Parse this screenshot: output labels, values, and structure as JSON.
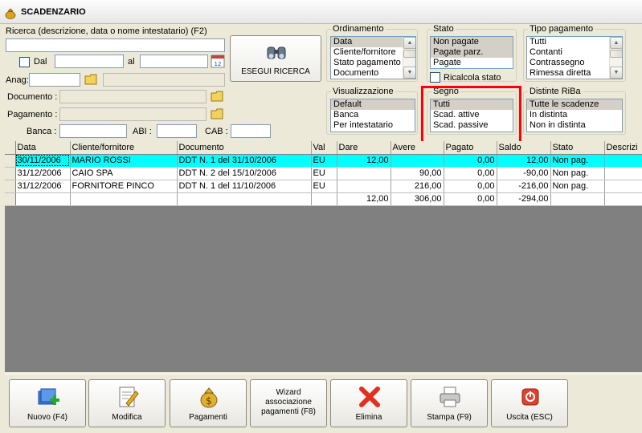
{
  "window": {
    "title": "SCADENZARIO"
  },
  "search": {
    "label": "Ricerca (descrizione, data o nome intestatario) (F2)",
    "value": "",
    "from_label": "Dal",
    "to_label": "al",
    "from_value": "",
    "to_value": "",
    "anag_label": "Anag:",
    "anag_value": "",
    "anag_desc": "",
    "documento_label": "Documento :",
    "documento_value": "",
    "pagamento_label": "Pagamento :",
    "pagamento_value": "",
    "banca_label": "Banca :",
    "banca_value": "",
    "abi_label": "ABI :",
    "abi_value": "",
    "cab_label": "CAB :",
    "cab_value": "",
    "button_label": "ESEGUI RICERCA"
  },
  "ordinamento": {
    "title": "Ordinamento",
    "items": [
      "Data",
      "Cliente/fornitore",
      "Stato pagamento",
      "Documento"
    ],
    "selected": 0
  },
  "stato": {
    "title": "Stato",
    "items": [
      "Non pagate",
      "Pagate parz.",
      "Pagate"
    ],
    "ricalcola_label": "Ricalcola stato"
  },
  "tipo_pagamento": {
    "title": "Tipo pagamento",
    "items": [
      "Tutti",
      "Contanti",
      "Contrassegno",
      "Rimessa diretta"
    ]
  },
  "visualizzazione": {
    "title": "Visualizzazione",
    "items": [
      "Default",
      "Banca",
      "Per intestatario"
    ]
  },
  "segno": {
    "title": "Segno",
    "items": [
      "Tutti",
      "Scad. attive",
      "Scad. passive"
    ]
  },
  "distinte_riba": {
    "title": "Distinte RiBa",
    "items": [
      "Tutte le scadenze",
      "In distinta",
      "Non in distinta"
    ]
  },
  "grid": {
    "columns": [
      "Data",
      "Cliente/fornitore",
      "Documento",
      "Val",
      "Dare",
      "Avere",
      "Pagato",
      "Saldo",
      "Stato",
      "Descrizi"
    ],
    "rows": [
      [
        "30/11/2006",
        "MARIO ROSSI",
        "DDT N. 1 del 31/10/2006",
        "EU",
        "12,00",
        "",
        "0,00",
        "12,00",
        "Non pag.",
        ""
      ],
      [
        "31/12/2006",
        "CAIO SPA",
        "DDT N. 2 del 15/10/2006",
        "EU",
        "",
        "90,00",
        "0,00",
        "-90,00",
        "Non pag.",
        ""
      ],
      [
        "31/12/2006",
        "FORNITORE PINCO",
        "DDT N. 1 del 11/10/2006",
        "EU",
        "",
        "216,00",
        "0,00",
        "-216,00",
        "Non pag.",
        ""
      ]
    ],
    "totals": [
      "",
      "",
      "",
      "",
      "12,00",
      "306,00",
      "0,00",
      "-294,00",
      "",
      ""
    ]
  },
  "toolbar": {
    "nuovo": "Nuovo (F4)",
    "modifica": "Modifica",
    "pagamenti": "Pagamenti",
    "wizard_line1": "Wizard",
    "wizard_line2": "associazione",
    "wizard_line3": "pagamenti (F8)",
    "elimina": "Elimina",
    "stampa": "Stampa (F9)",
    "uscita": "Uscita (ESC)"
  },
  "colors": {
    "selected_row": "#00ffff",
    "highlight_box": "#ff0000",
    "window_bg": "#ece9d8"
  }
}
